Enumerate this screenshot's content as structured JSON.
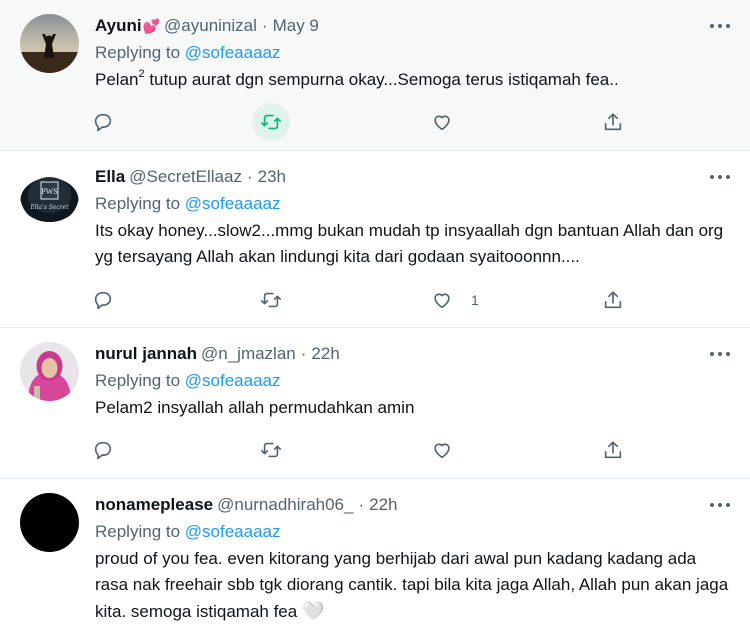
{
  "tweets": [
    {
      "name": "Ayuni",
      "name_emoji": "💕",
      "handle": "@ayuninizal",
      "dot": "·",
      "time": "May 9",
      "reply_prefix": "Replying to",
      "reply_to": "@sofeaaaaz",
      "text_a": "Pelan",
      "text_sup": "2",
      "text_b": " tutup aurat dgn sempurna okay...Semoga terus istiqamah fea..",
      "like_count": "",
      "highlighted": true
    },
    {
      "name": "Ella",
      "handle": "@SecretEllaaz",
      "dot": "·",
      "time": "23h",
      "reply_prefix": "Replying to",
      "reply_to": "@sofeaaaaz",
      "text": "Its okay honey...slow2...mmg bukan mudah tp insyaallah dgn bantuan Allah dan org yg tersayang Allah akan lindungi kita dari godaan syaitooonnn....",
      "like_count": "1"
    },
    {
      "name": "nurul jannah",
      "handle": "@n_jmazlan",
      "dot": "·",
      "time": "22h",
      "reply_prefix": "Replying to",
      "reply_to": "@sofeaaaaz",
      "text": "Pelam2 insyallah allah permudahkan amin",
      "like_count": ""
    },
    {
      "name": "nonameplease",
      "handle": "@nurnadhirah06_",
      "dot": "·",
      "time": "22h",
      "reply_prefix": "Replying to",
      "reply_to": "@sofeaaaaz",
      "text": "proud of you fea. even kitorang yang berhijab dari awal pun kadang kadang ada rasa nak freehair sbb tgk diorang cantik. tapi bila kita jaga Allah, Allah pun akan jaga kita. semoga istiqamah fea",
      "text_emoji": "🤍"
    }
  ],
  "avatar_texts": {
    "ella_logo": "PWS",
    "ella_script": "Ella's Secret"
  },
  "icons": {
    "reply": "comment-icon",
    "retweet": "retweet-icon",
    "like": "heart-icon",
    "share": "share-icon",
    "more": "more-icon"
  },
  "colors": {
    "link": "#1d9bf0",
    "secondary_text": "#536471",
    "primary_text": "#0f1419",
    "highlight_bg": "#f7f9f9",
    "retweet_hover": "#00ba7c",
    "divider": "#e6ecf0"
  }
}
